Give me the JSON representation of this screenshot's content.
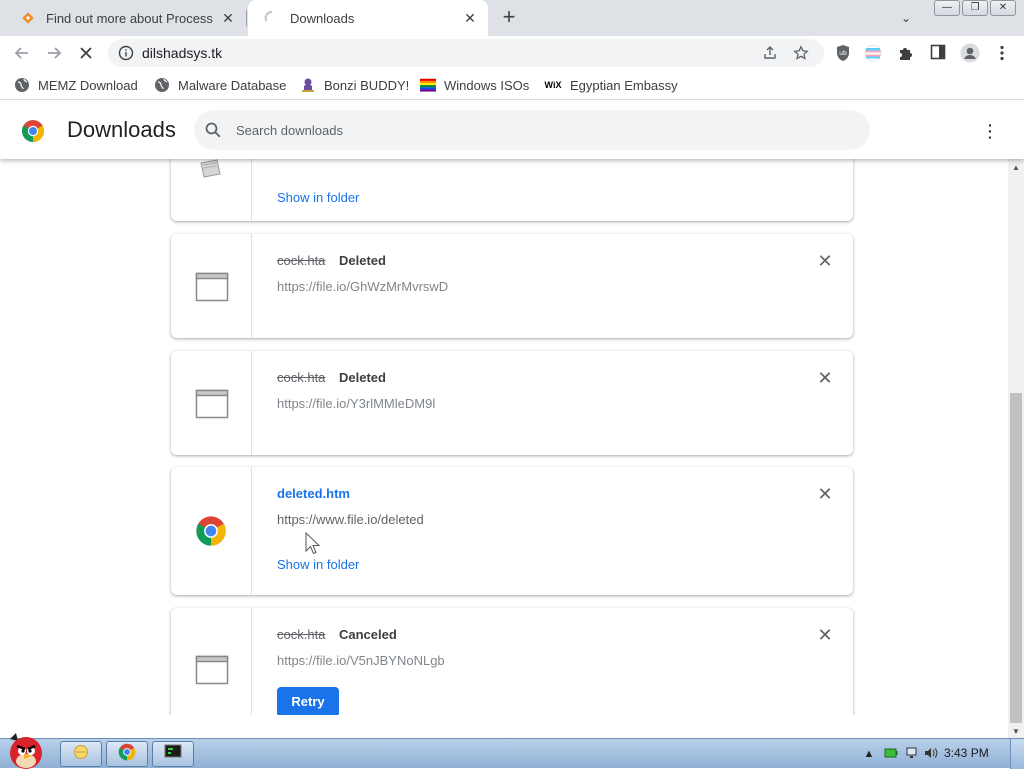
{
  "tabs": [
    {
      "title": "Find out more about Process H",
      "favicon": "diamond-orange-icon",
      "close": "✕"
    },
    {
      "title": "Downloads",
      "favicon": "loading-spinner-icon",
      "close": "✕"
    }
  ],
  "new_tab": "+",
  "tab_search": "⌄",
  "window_buttons": {
    "minimize": "—",
    "restore": "❐",
    "close": "✕"
  },
  "toolbar": {
    "url": "dilshadsys.tk",
    "icons": [
      "back-icon",
      "forward-icon",
      "stop-icon",
      "info-icon",
      "share-icon",
      "star-icon",
      "ublock-icon",
      "flag-icon",
      "extensions-icon",
      "sidepanel-icon",
      "profile-icon",
      "menu-icon"
    ]
  },
  "bookmarks": [
    {
      "label": "MEMZ Download",
      "icon": "globe-icon"
    },
    {
      "label": "Malware Database",
      "icon": "globe-icon"
    },
    {
      "label": "Bonzi BUDDY!",
      "icon": "bonzi-icon"
    },
    {
      "label": "Windows ISOs",
      "icon": "rainbow-flag-icon"
    },
    {
      "label": "Egyptian Embassy",
      "icon": "wix-icon",
      "icon_text": "WiX"
    }
  ],
  "downloads_header": {
    "title": "Downloads",
    "search_placeholder": "Search downloads",
    "more": "⋮"
  },
  "downloads": [
    {
      "action": "Show in folder"
    },
    {
      "name": "cock.hta",
      "status": "Deleted",
      "url": "https://file.io/GhWzMrMvrswD"
    },
    {
      "name": "cock.hta",
      "status": "Deleted",
      "url": "https://file.io/Y3rlMMleDM9l"
    },
    {
      "name": "deleted.htm",
      "url": "https://www.file.io/deleted",
      "action": "Show in folder"
    },
    {
      "name": "cock.hta",
      "status": "Canceled",
      "url": "https://file.io/V5nJBYNoNLgb",
      "button": "Retry"
    }
  ],
  "close_glyph": "✕",
  "taskbar": {
    "clock": "3:43 PM"
  },
  "colors": {
    "link": "#1a73e8",
    "tabstrip": "#dee1e6",
    "taskbar": "#a8c4e4"
  }
}
